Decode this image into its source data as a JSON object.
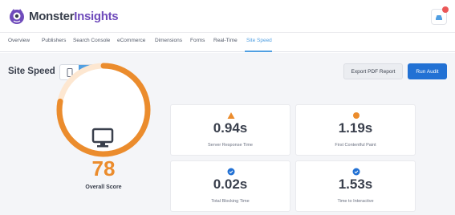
{
  "brand": {
    "name_part1": "Monster",
    "name_part2": "Insights"
  },
  "tabs": [
    {
      "label": "Overview"
    },
    {
      "label": "Publishers"
    },
    {
      "label": "Search Console"
    },
    {
      "label": "eCommerce"
    },
    {
      "label": "Dimensions"
    },
    {
      "label": "Forms"
    },
    {
      "label": "Real-Time"
    },
    {
      "label": "Site Speed",
      "active": true
    }
  ],
  "page": {
    "title": "Site Speed",
    "device_toggle": [
      "mobile-icon",
      "desktop-icon"
    ],
    "active_device": "desktop",
    "export_label": "Export PDF Report",
    "audit_label": "Run Audit"
  },
  "overall": {
    "score": "78",
    "label": "Overall Score",
    "gauge_fraction": 0.78,
    "color": "#eb8c2d"
  },
  "metrics": [
    {
      "value": "0.94s",
      "label": "Server Response Time",
      "status": "warning",
      "color": "#eb8c2d"
    },
    {
      "value": "1.19s",
      "label": "First Contentful Paint",
      "status": "warning",
      "color": "#eb8c2d"
    },
    {
      "value": "0.02s",
      "label": "Total Blocking Time",
      "status": "good",
      "color": "#2271d4"
    },
    {
      "value": "1.53s",
      "label": "Time to Interactive",
      "status": "good",
      "color": "#2271d4"
    }
  ],
  "colors": {
    "accent": "#509fe2",
    "primary_button": "#2271d4",
    "brand_purple": "#6f4bbb"
  }
}
